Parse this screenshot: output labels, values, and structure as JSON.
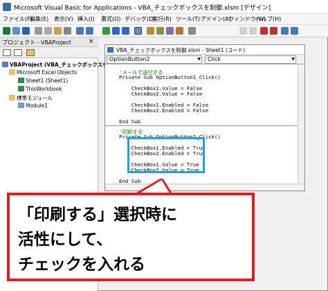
{
  "app": {
    "title": "Microsoft Visual Basic for Applications - VBA_チェックボックスを制御.xlsm [デザイン]"
  },
  "menu": [
    "ファイル(F)",
    "編集(E)",
    "表示(V)",
    "挿入(I)",
    "書式(O)",
    "デバッグ(D)",
    "実行(R)",
    "ツール(T)",
    "アドイン(A)",
    "ウィンドウ(W)",
    "ヘルプ(H)"
  ],
  "project": {
    "title": "プロジェクト - VBAProject",
    "close": "×",
    "tree": [
      "VBAProject (VBA_チェックボックスを制",
      "Microsoft Excel Objects",
      "Sheet1 (Sheet1)",
      "ThisWorkbook",
      "標準モジュール",
      "Module1"
    ]
  },
  "codewin": {
    "title": "VBA_チェックボックスを制御.xlsm - Sheet1 (コード)",
    "object_select": "OptionButton2",
    "proc_select": "Click",
    "lines1": [
      "'メールで送付する",
      "Private Sub OptionButton1_Click()",
      "",
      "    CheckBox1.Value = False",
      "    CheckBox2.Value = False",
      "",
      "    CheckBox1.Enabled = False",
      "    CheckBox2.Enabled = False",
      "",
      "End Sub"
    ],
    "lines2": [
      "'印刷する",
      "Private Sub OptionButton2_Click()",
      "",
      "    CheckBox1.Enabled = True",
      "    CheckBox2.Enabled = True",
      "",
      "    CheckBox1.Value = True",
      "    CheckBox2.Value = True",
      "",
      "End Sub"
    ]
  },
  "callout": {
    "text": "「印刷する」選択時に\n活性にして、\nチェックを入れる"
  },
  "colors": {
    "accent_red": "#d82020",
    "highlight_blue": "#1aa0e0",
    "comment_green": "#008000"
  }
}
